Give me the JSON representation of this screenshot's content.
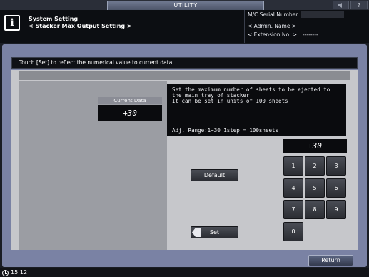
{
  "topbar": {
    "tab_label": "UTILITY",
    "sound_icon": "speaker-icon",
    "help_label": "?"
  },
  "header": {
    "icon": "info-icon",
    "icon_glyph": "i",
    "title_line1": "System Setting",
    "title_line2": "< Stacker Max Output Setting >",
    "serial_label": "M/C Serial Number:",
    "admin_label": "< Admin. Name >",
    "extension_label": "< Extension No. >",
    "extension_value": "--------"
  },
  "message": "Touch [Set] to reflect the numerical value to current data",
  "current_data": {
    "label": "Current Data",
    "value": "+30"
  },
  "description": {
    "line1": "Set the maximum number of sheets to be ejected to",
    "line2": "the main tray of stacker",
    "line3": "It can be set in units of 100 sheets",
    "range": "Adj. Range:1~30 1step = 100sheets"
  },
  "input_value": "+30",
  "buttons": {
    "default": "Default",
    "set": "Set",
    "return": "Return"
  },
  "keypad": [
    "1",
    "2",
    "3",
    "4",
    "5",
    "6",
    "7",
    "8",
    "9",
    "0"
  ],
  "footer": {
    "time": "15:12",
    "icon": "clock-icon"
  }
}
